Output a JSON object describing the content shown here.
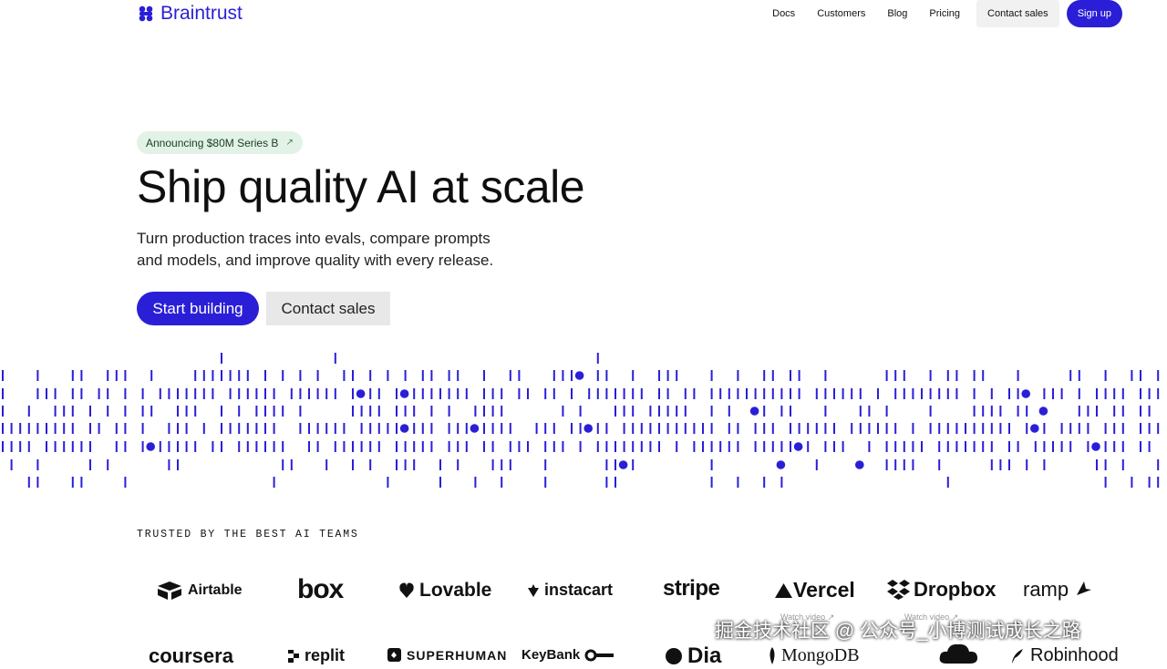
{
  "nav": {
    "brand": "Braintrust",
    "links": [
      "Docs",
      "Customers",
      "Blog",
      "Pricing"
    ],
    "contact": "Contact sales",
    "signup": "Sign up"
  },
  "hero": {
    "announcement": "Announcing $80M Series B",
    "announcement_arrow": "↗",
    "title": "Ship quality AI at scale",
    "subtitle_line1": "Turn production traces into evals, compare prompts",
    "subtitle_line2": "and models, and improve quality with every release.",
    "primary_cta": "Start building",
    "secondary_cta": "Contact sales"
  },
  "colors": {
    "accent": "#2a1fd6",
    "announce_bg": "#e2f2e6"
  },
  "trusted": {
    "heading": "TRUSTED BY THE BEST AI TEAMS",
    "logos_row1": [
      "Airtable",
      "box",
      "Lovable",
      "instacart",
      "stripe",
      "Vercel",
      "Dropbox",
      "ramp"
    ],
    "logos_row2": [
      "coursera",
      "replit",
      "SUPERHUMAN",
      "KeyBank",
      "Dia",
      "MongoDB",
      "Robinhood"
    ],
    "watch_video": "Watch video ↗"
  },
  "watermark": "掘金技术社区 @ 公众号_小博测试成长之路"
}
